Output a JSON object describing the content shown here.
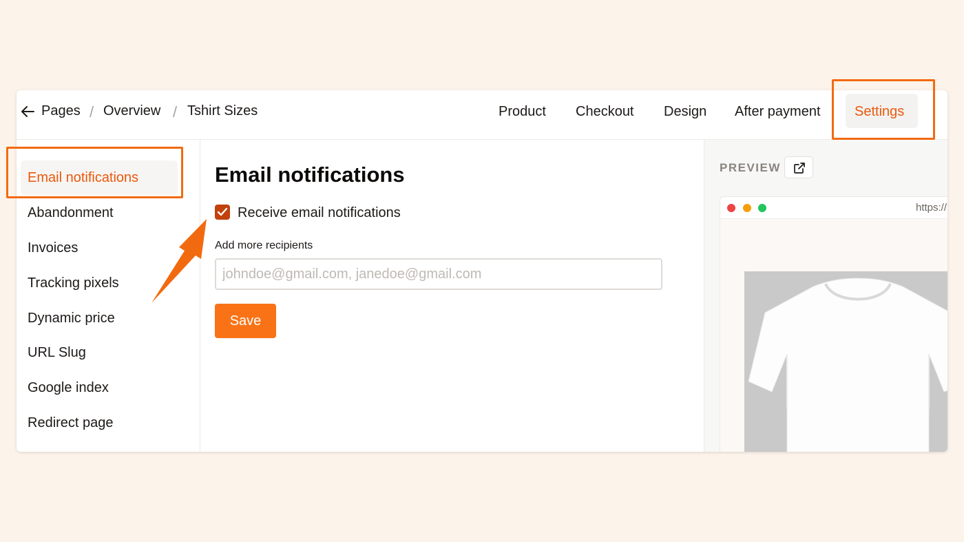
{
  "breadcrumb": {
    "items": [
      "Pages",
      "Overview",
      "Tshirt Sizes"
    ],
    "separator": "/"
  },
  "tabs": [
    {
      "label": "Product"
    },
    {
      "label": "Checkout"
    },
    {
      "label": "Design"
    },
    {
      "label": "After payment"
    },
    {
      "label": "Settings",
      "active": true
    }
  ],
  "sidebar": {
    "items": [
      {
        "label": "Email notifications",
        "active": true
      },
      {
        "label": "Abandonment"
      },
      {
        "label": "Invoices"
      },
      {
        "label": "Tracking pixels"
      },
      {
        "label": "Dynamic price"
      },
      {
        "label": "URL Slug"
      },
      {
        "label": "Google index"
      },
      {
        "label": "Redirect page"
      }
    ]
  },
  "main": {
    "title": "Email notifications",
    "checkbox_label": "Receive email notifications",
    "checkbox_checked": true,
    "recipients_label": "Add more recipients",
    "recipients_value": "",
    "recipients_placeholder": "johndoe@gmail.com, janedoe@gmail.com",
    "save_label": "Save"
  },
  "preview": {
    "label": "PREVIEW",
    "url": "https://",
    "product_image": "white-tshirt"
  },
  "colors": {
    "accent": "#ea580c",
    "button": "#f97316",
    "annotation": "#f26a10",
    "background": "#fcf3ea",
    "dot_red": "#ef4444",
    "dot_yellow": "#f59e0b",
    "dot_green": "#22c55e"
  },
  "icons": [
    "arrow-left-icon",
    "external-link-icon",
    "check-icon"
  ]
}
